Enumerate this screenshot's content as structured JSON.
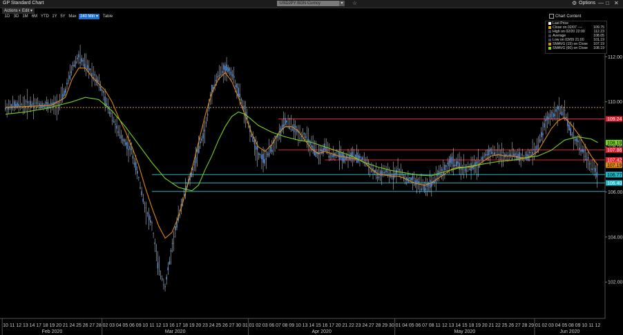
{
  "window": {
    "title": "GP Standard Chart",
    "ticker": "USDJPY BGN Curncy",
    "options_label": "Options",
    "gear_icon": "gear-icon",
    "minimize_glyph": "—",
    "maximize_glyph": "□",
    "close_glyph": "✕",
    "favorite_glyph": "☆"
  },
  "menu": {
    "actions": "Actions ▾",
    "edit": "Edit ▾"
  },
  "ranges": [
    {
      "label": "1D",
      "active": false
    },
    {
      "label": "3D",
      "active": false
    },
    {
      "label": "1M",
      "active": false
    },
    {
      "label": "6M",
      "active": false
    },
    {
      "label": "YTD",
      "active": false
    },
    {
      "label": "1Y",
      "active": false
    },
    {
      "label": "5Y",
      "active": false
    },
    {
      "label": "Max",
      "active": false
    },
    {
      "label": "240 Min ▾",
      "active": true
    },
    {
      "label": "Table",
      "active": false
    }
  ],
  "chart_content_label": "Chart Content",
  "legend": [
    {
      "label": "Last Price",
      "value": "",
      "color": "#ffffff"
    },
    {
      "label": "Close on 02/07 ----",
      "value": "109.75",
      "color": "#e0a020"
    },
    {
      "label": "High on 02/20 22:00",
      "value": "112.23",
      "color": "#444444"
    },
    {
      "label": "Average",
      "value": "108.05",
      "color": "#444444"
    },
    {
      "label": "Low on 03/09 21:00",
      "value": "101.19",
      "color": "#444444"
    },
    {
      "label": "SMAVG (15) on Close",
      "value": "107.19",
      "color": "#e08a10"
    },
    {
      "label": "SMAVG (60) on Close",
      "value": "108.19",
      "color": "#8ed820"
    }
  ],
  "colors": {
    "price": "#5a8fd8",
    "sma15": "#e08a10",
    "sma60": "#7bd21e",
    "red_line": "#e0202e",
    "cyan_line": "#19b8c8",
    "dotted": "#d49a18"
  },
  "chart_data": {
    "type": "line",
    "title": "",
    "xlabel": "",
    "ylabel": "",
    "ylim": [
      100.6,
      113.6
    ],
    "y_ticks": [
      "112.00",
      "110.00",
      "108.00",
      "106.00",
      "104.00",
      "102.00"
    ],
    "x_day_labels": [
      "10",
      "11",
      "12",
      "13",
      "14",
      "17",
      "18",
      "19",
      "20",
      "21",
      "24",
      "25",
      "26",
      "27",
      "28",
      "02",
      "03",
      "04",
      "05",
      "06",
      "09",
      "10",
      "11",
      "12",
      "13",
      "16",
      "17",
      "18",
      "19",
      "20",
      "23",
      "24",
      "25",
      "26",
      "27",
      "30",
      "31",
      "01",
      "02",
      "03",
      "06",
      "07",
      "08",
      "09",
      "10",
      "13",
      "14",
      "15",
      "16",
      "17",
      "20",
      "21",
      "22",
      "23",
      "24",
      "27",
      "28",
      "29",
      "30",
      "01",
      "04",
      "05",
      "06",
      "07",
      "08",
      "11",
      "12",
      "13",
      "14",
      "15",
      "18",
      "19",
      "20",
      "21",
      "22",
      "25",
      "26",
      "27",
      "28",
      "29",
      "01",
      "02",
      "03",
      "04",
      "05",
      "08",
      "09",
      "10",
      "11",
      "12"
    ],
    "months": [
      "Feb 2020",
      "Mar 2020",
      "Apr 2020",
      "May 2020",
      "Jun 2020"
    ],
    "month_start_index": [
      0,
      15,
      37,
      59,
      80
    ],
    "series": [
      {
        "key": "price",
        "values": [
          [
            0,
            109.75
          ],
          [
            2,
            109.85
          ],
          [
            4,
            109.9
          ],
          [
            6,
            109.85
          ],
          [
            7,
            109.8
          ],
          [
            8,
            109.9
          ],
          [
            9,
            110.5
          ],
          [
            10,
            111.5
          ],
          [
            11,
            112.0
          ],
          [
            12,
            111.6
          ],
          [
            13,
            111.3
          ],
          [
            14,
            110.9
          ],
          [
            15,
            110.0
          ],
          [
            16,
            109.4
          ],
          [
            17,
            108.6
          ],
          [
            18,
            108.2
          ],
          [
            19,
            107.8
          ],
          [
            20,
            106.6
          ],
          [
            21,
            105.3
          ],
          [
            22,
            104.5
          ],
          [
            23,
            102.6
          ],
          [
            24,
            101.8
          ],
          [
            25,
            103.5
          ],
          [
            26,
            104.9
          ],
          [
            27,
            106.1
          ],
          [
            28,
            106.8
          ],
          [
            29,
            107.9
          ],
          [
            30,
            108.8
          ],
          [
            31,
            110.5
          ],
          [
            32,
            111.2
          ],
          [
            33,
            111.5
          ],
          [
            34,
            111.3
          ],
          [
            35,
            110.4
          ],
          [
            36,
            109.5
          ],
          [
            37,
            108.5
          ],
          [
            38,
            107.7
          ],
          [
            39,
            107.4
          ],
          [
            40,
            108.0
          ],
          [
            41,
            108.5
          ],
          [
            42,
            109.1
          ],
          [
            43,
            108.9
          ],
          [
            44,
            108.6
          ],
          [
            45,
            108.5
          ],
          [
            46,
            108.0
          ],
          [
            47,
            107.6
          ],
          [
            48,
            108.0
          ],
          [
            49,
            107.6
          ],
          [
            50,
            107.7
          ],
          [
            51,
            107.5
          ],
          [
            52,
            107.6
          ],
          [
            53,
            107.5
          ],
          [
            54,
            107.4
          ],
          [
            55,
            107.0
          ],
          [
            56,
            106.7
          ],
          [
            57,
            106.9
          ],
          [
            58,
            106.7
          ],
          [
            59,
            107.0
          ],
          [
            60,
            106.6
          ],
          [
            61,
            106.5
          ],
          [
            62,
            106.4
          ],
          [
            63,
            106.2
          ],
          [
            64,
            106.4
          ],
          [
            65,
            106.8
          ],
          [
            66,
            107.0
          ],
          [
            67,
            107.4
          ],
          [
            68,
            107.2
          ],
          [
            69,
            107.0
          ],
          [
            70,
            107.1
          ],
          [
            71,
            107.2
          ],
          [
            72,
            107.6
          ],
          [
            73,
            107.8
          ],
          [
            74,
            107.7
          ],
          [
            75,
            107.6
          ],
          [
            76,
            107.7
          ],
          [
            77,
            107.6
          ],
          [
            78,
            107.5
          ],
          [
            79,
            107.7
          ],
          [
            80,
            108.0
          ],
          [
            81,
            109.0
          ],
          [
            82,
            109.4
          ],
          [
            83,
            109.65
          ],
          [
            84,
            109.5
          ],
          [
            85,
            108.6
          ],
          [
            86,
            108.2
          ],
          [
            87,
            107.7
          ],
          [
            88,
            107.1
          ],
          [
            89,
            106.78
          ]
        ]
      },
      {
        "key": "sma15",
        "values": [
          [
            0,
            109.75
          ],
          [
            4,
            109.8
          ],
          [
            7,
            109.85
          ],
          [
            9,
            110.2
          ],
          [
            10,
            111.0
          ],
          [
            11,
            111.5
          ],
          [
            12,
            111.5
          ],
          [
            13,
            111.1
          ],
          [
            14,
            110.8
          ],
          [
            15,
            110.5
          ],
          [
            16,
            110.0
          ],
          [
            17,
            109.3
          ],
          [
            18,
            108.7
          ],
          [
            19,
            108.0
          ],
          [
            20,
            107.2
          ],
          [
            21,
            106.2
          ],
          [
            22,
            105.3
          ],
          [
            23,
            104.5
          ],
          [
            24,
            103.95
          ],
          [
            25,
            104.2
          ],
          [
            26,
            104.9
          ],
          [
            27,
            105.9
          ],
          [
            28,
            107.0
          ],
          [
            29,
            108.2
          ],
          [
            30,
            109.4
          ],
          [
            31,
            110.4
          ],
          [
            32,
            111.0
          ],
          [
            33,
            111.3
          ],
          [
            34,
            110.9
          ],
          [
            35,
            110.2
          ],
          [
            36,
            109.4
          ],
          [
            37,
            108.6
          ],
          [
            38,
            108.0
          ],
          [
            39,
            107.8
          ],
          [
            40,
            108.1
          ],
          [
            41,
            108.6
          ],
          [
            42,
            108.9
          ],
          [
            43,
            108.9
          ],
          [
            44,
            108.7
          ],
          [
            45,
            108.3
          ],
          [
            46,
            107.9
          ],
          [
            47,
            107.7
          ],
          [
            48,
            107.8
          ],
          [
            49,
            107.7
          ],
          [
            50,
            107.6
          ],
          [
            51,
            107.55
          ],
          [
            52,
            107.5
          ],
          [
            53,
            107.45
          ],
          [
            54,
            107.3
          ],
          [
            55,
            107.0
          ],
          [
            56,
            106.8
          ],
          [
            57,
            106.75
          ],
          [
            58,
            106.7
          ],
          [
            59,
            106.7
          ],
          [
            60,
            106.6
          ],
          [
            61,
            106.45
          ],
          [
            62,
            106.35
          ],
          [
            63,
            106.3
          ],
          [
            64,
            106.4
          ],
          [
            65,
            106.6
          ],
          [
            66,
            106.8
          ],
          [
            67,
            107.0
          ],
          [
            68,
            107.1
          ],
          [
            69,
            107.1
          ],
          [
            70,
            107.1
          ],
          [
            71,
            107.2
          ],
          [
            72,
            107.4
          ],
          [
            73,
            107.6
          ],
          [
            74,
            107.65
          ],
          [
            75,
            107.6
          ],
          [
            76,
            107.6
          ],
          [
            77,
            107.55
          ],
          [
            78,
            107.5
          ],
          [
            79,
            107.6
          ],
          [
            80,
            107.8
          ],
          [
            81,
            108.3
          ],
          [
            82,
            108.8
          ],
          [
            83,
            109.15
          ],
          [
            84,
            109.3
          ],
          [
            85,
            109.0
          ],
          [
            86,
            108.6
          ],
          [
            87,
            108.1
          ],
          [
            88,
            107.6
          ],
          [
            89,
            107.19
          ]
        ]
      },
      {
        "key": "sma60",
        "values": [
          [
            0,
            109.45
          ],
          [
            3,
            109.55
          ],
          [
            6,
            109.7
          ],
          [
            8,
            109.85
          ],
          [
            10,
            110.0
          ],
          [
            12,
            110.2
          ],
          [
            14,
            110.1
          ],
          [
            16,
            109.6
          ],
          [
            18,
            108.9
          ],
          [
            20,
            108.1
          ],
          [
            22,
            107.3
          ],
          [
            24,
            106.6
          ],
          [
            26,
            106.2
          ],
          [
            28,
            106.05
          ],
          [
            29,
            106.3
          ],
          [
            30,
            107.0
          ],
          [
            31,
            107.6
          ],
          [
            32,
            108.3
          ],
          [
            33,
            108.9
          ],
          [
            34,
            109.35
          ],
          [
            35,
            109.55
          ],
          [
            36,
            109.45
          ],
          [
            37,
            109.2
          ],
          [
            38,
            108.95
          ],
          [
            40,
            108.65
          ],
          [
            42,
            108.45
          ],
          [
            44,
            108.3
          ],
          [
            46,
            108.2
          ],
          [
            48,
            108.0
          ],
          [
            50,
            107.8
          ],
          [
            52,
            107.6
          ],
          [
            54,
            107.3
          ],
          [
            56,
            107.1
          ],
          [
            58,
            106.95
          ],
          [
            60,
            106.85
          ],
          [
            62,
            106.75
          ],
          [
            64,
            106.72
          ],
          [
            66,
            106.9
          ],
          [
            68,
            107.05
          ],
          [
            70,
            107.15
          ],
          [
            72,
            107.25
          ],
          [
            74,
            107.35
          ],
          [
            76,
            107.4
          ],
          [
            78,
            107.5
          ],
          [
            80,
            107.6
          ],
          [
            82,
            107.85
          ],
          [
            84,
            108.3
          ],
          [
            86,
            108.45
          ],
          [
            88,
            108.35
          ],
          [
            89,
            108.19
          ]
        ]
      }
    ],
    "horizontal_lines": [
      {
        "kind": "dotted",
        "value": 109.75,
        "from": 0,
        "label": ""
      },
      {
        "kind": "red",
        "value": 109.24,
        "from": 41,
        "label": "109.24"
      },
      {
        "kind": "red",
        "value": 107.86,
        "from": 41,
        "label": "107.86"
      },
      {
        "kind": "red",
        "value": 107.42,
        "from": 48,
        "label": "107.42"
      },
      {
        "kind": "cyan",
        "value": 106.77,
        "from": 22,
        "label": "106.77"
      },
      {
        "kind": "cyan",
        "value": 106.4,
        "from": 25,
        "label": "106.40"
      },
      {
        "kind": "cyan",
        "value": 106.02,
        "from": 22,
        "label": ""
      }
    ],
    "value_tags": [
      {
        "value": 108.19,
        "label": "108.19",
        "color": "#7bd21e",
        "text_color": "#000000"
      },
      {
        "value": 107.19,
        "label": "107.19",
        "color": "#e08a10",
        "text_color": "#000000"
      },
      {
        "value": 106.77,
        "label": "106.77",
        "color": "#19b8c8",
        "text_color": "#000000"
      }
    ]
  }
}
